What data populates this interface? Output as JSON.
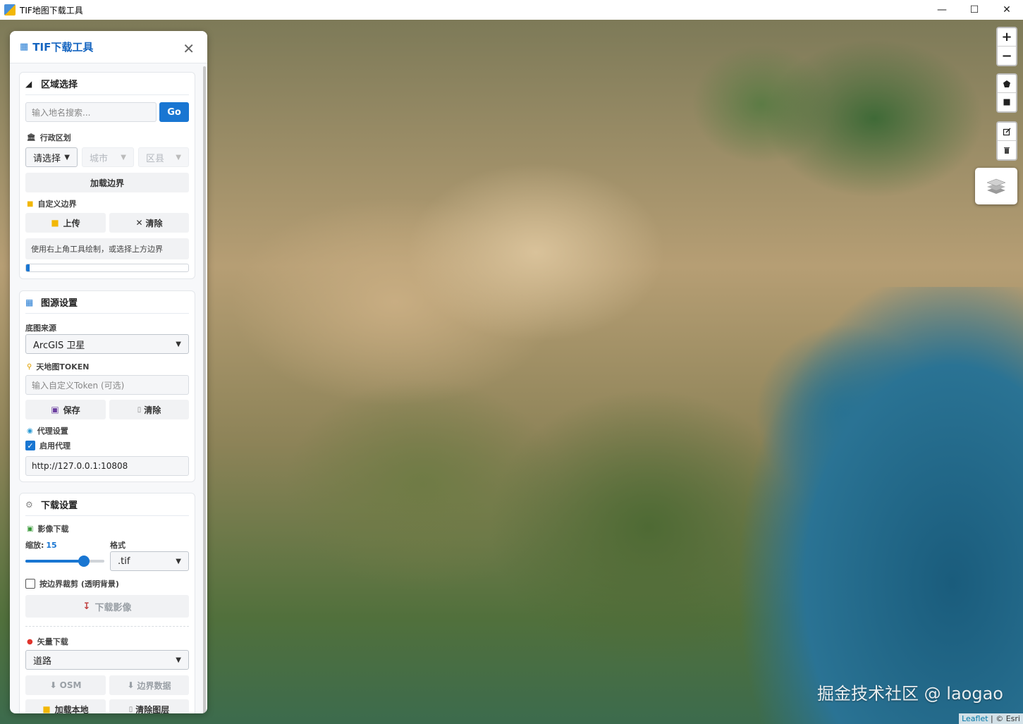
{
  "window": {
    "title": "TIF地图下载工具"
  },
  "panel": {
    "title": "TIF下载工具",
    "region": {
      "heading": "区域选择",
      "search_placeholder": "输入地名搜索...",
      "search_button": "Go",
      "admin_label": "行政区划",
      "province_select": "请选择",
      "city_select": "城市",
      "county_select": "区县",
      "load_boundary_button": "加载边界",
      "custom_boundary_label": "自定义边界",
      "upload_button": "上传",
      "clear_button": "清除",
      "hint": "使用右上角工具绘制，或选择上方边界",
      "progress": 0.01
    },
    "source": {
      "heading": "图源设置",
      "basemap_label": "底图来源",
      "basemap_select": "ArcGIS 卫星",
      "token_label": "天地图TOKEN",
      "token_placeholder": "输入自定义Token (可选)",
      "save_button": "保存",
      "clear_button": "清除",
      "proxy_label": "代理设置",
      "proxy_enabled_label": "启用代理",
      "proxy_enabled": true,
      "proxy_value": "http://127.0.0.1:10808"
    },
    "download": {
      "heading": "下载设置",
      "image_label": "影像下载",
      "zoom_label": "缩放:",
      "zoom_value": "15",
      "zoom_fraction": 0.78,
      "format_label": "格式",
      "format_select": ".tif",
      "clip_label": "按边界裁剪 (透明背景)",
      "clip_checked": false,
      "download_image_button": "下载影像",
      "vector_label": "矢量下载",
      "vector_select": "道路",
      "osm_button": "OSM",
      "boundary_data_button": "边界数据",
      "load_local_button": "加载本地",
      "clear_layer_button": "清除图层"
    }
  },
  "map": {
    "zoom_in": "+",
    "zoom_out": "−",
    "attribution_leaflet": "Leaflet",
    "attribution_rest": "| © Esri",
    "watermark": "掘金技术社区 @ laogao"
  }
}
